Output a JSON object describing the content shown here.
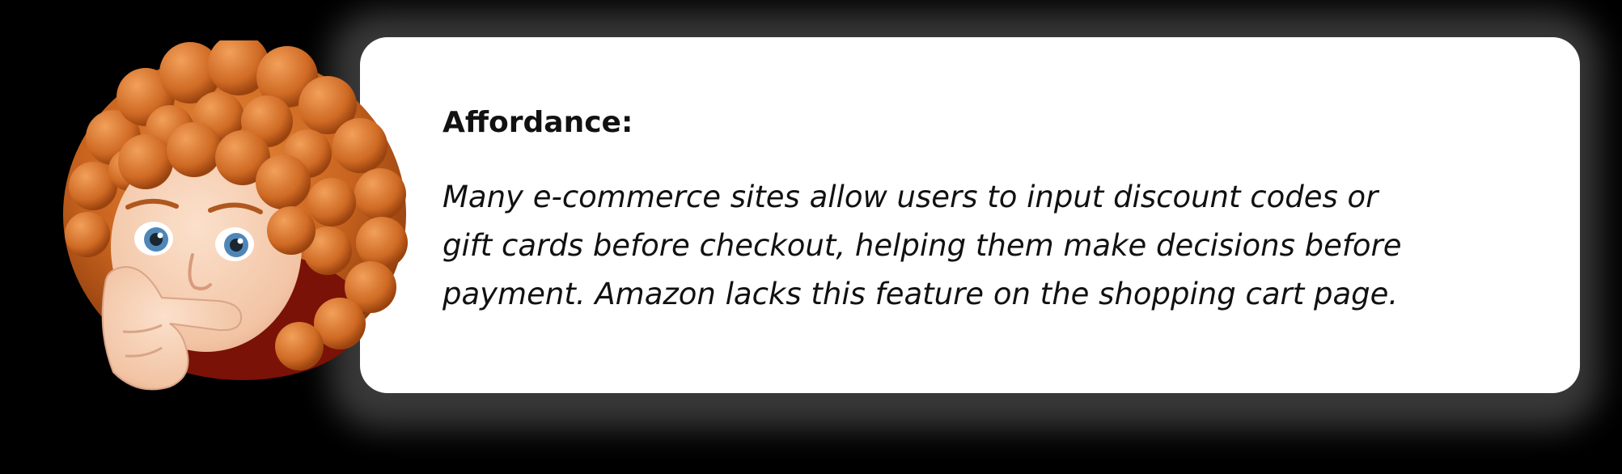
{
  "callout": {
    "heading": "Affordance:",
    "body": "Many e-commerce sites allow users to input discount codes or\ngift cards before checkout, helping them make decisions before\npayment. Amazon lacks this feature on the shopping cart page."
  },
  "avatar": {
    "icon": "thinking-memoji-avatar-icon",
    "hair_color": "#d2691e",
    "skin_color": "#f7cdb0"
  },
  "colors": {
    "background": "#000000",
    "card": "#ffffff",
    "text": "#111111"
  }
}
